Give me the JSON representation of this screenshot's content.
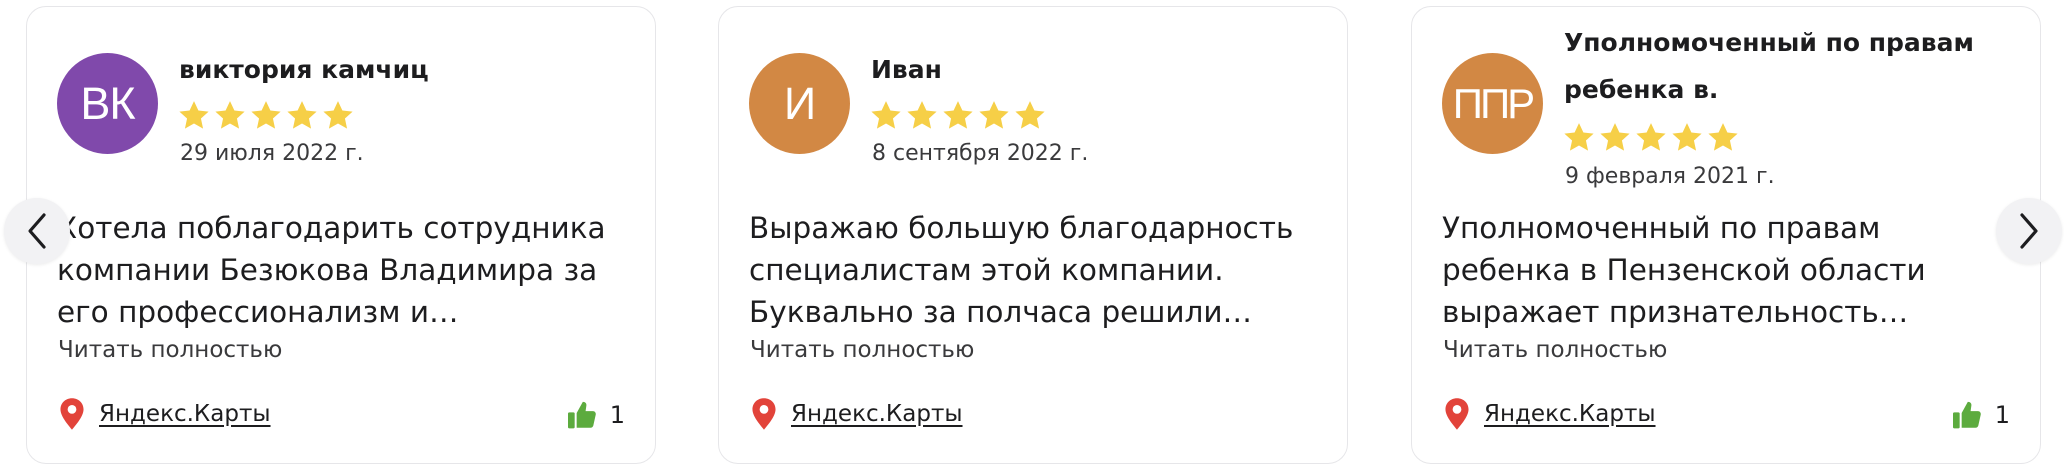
{
  "colors": {
    "star": "#f6cf47",
    "pin": "#e2433a",
    "thumb": "#5cab3e",
    "avatar_purple": "#8049ab",
    "avatar_orange": "#d28844"
  },
  "nav": {
    "prev_icon": "chevron-left-icon",
    "next_icon": "chevron-right-icon"
  },
  "reviews": [
    {
      "avatar_initials": "ВК",
      "avatar_color": "#8049ab",
      "author": "виктория камчиц",
      "rating": 5,
      "date": "29 июля 2022 г.",
      "text": "Хотела поблагодарить сотрудника компании Безюкова Владимира за его профессионализм и…",
      "read_more": "Читать полностью",
      "source": "Яндекс.Карты",
      "likes": "1"
    },
    {
      "avatar_initials": "И",
      "avatar_color": "#d28844",
      "author": "Иван",
      "rating": 5,
      "date": "8 сентября 2022 г.",
      "text": "Выражаю большую благодарность специалистам этой компании. Буквально за полчаса решили…",
      "read_more": "Читать полностью",
      "source": "Яндекс.Карты",
      "likes": ""
    },
    {
      "avatar_initials": "ППР",
      "avatar_color": "#d28844",
      "author": "Уполномоченный по правам ребенка в.",
      "rating": 5,
      "date": "9 февраля 2021 г.",
      "text": "Уполномоченный по правам ребенка в Пензенской области выражает признательность…",
      "read_more": "Читать полностью",
      "source": "Яндекс.Карты",
      "likes": "1"
    }
  ]
}
